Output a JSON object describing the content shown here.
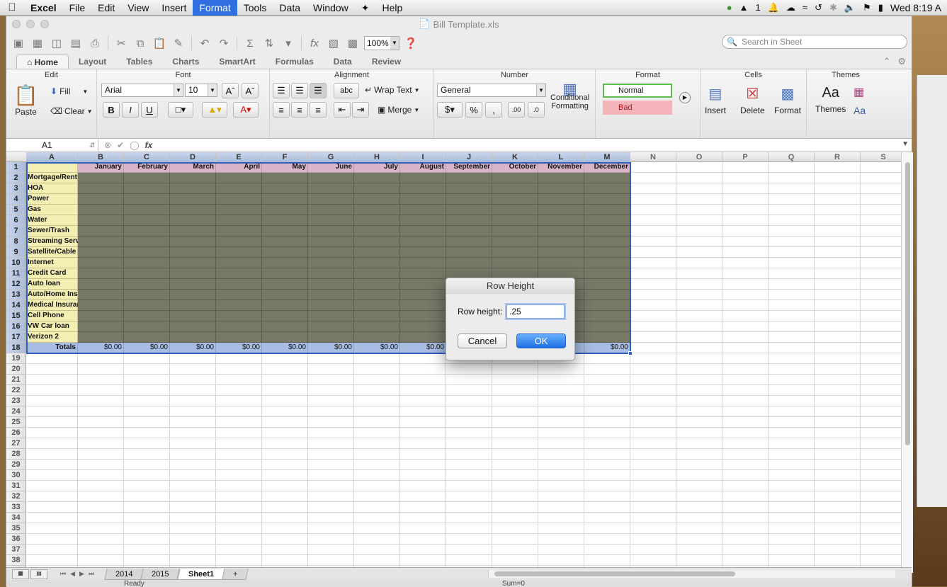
{
  "menubar": {
    "app": "Excel",
    "items": [
      "File",
      "Edit",
      "View",
      "Insert",
      "Format",
      "Tools",
      "Data",
      "Window",
      "Help"
    ],
    "active": "Format",
    "status": {
      "badge": "1",
      "clock": "Wed 8:19 A"
    }
  },
  "window": {
    "title": "Bill Template.xls"
  },
  "toolbar": {
    "zoom": "100%",
    "search_placeholder": "Search in Sheet"
  },
  "ribbon_tabs": [
    "Home",
    "Layout",
    "Tables",
    "Charts",
    "SmartArt",
    "Formulas",
    "Data",
    "Review"
  ],
  "ribbon": {
    "edit": {
      "label": "Edit",
      "paste": "Paste",
      "fill": "Fill",
      "clear": "Clear"
    },
    "font": {
      "label": "Font",
      "name": "Arial",
      "size": "10"
    },
    "alignment": {
      "label": "Alignment",
      "wrap": "Wrap Text",
      "merge": "Merge",
      "abc": "abc"
    },
    "number": {
      "label": "Number",
      "format": "General",
      "cond1": "Conditional",
      "cond2": "Formatting"
    },
    "format": {
      "label": "Format",
      "normal": "Normal",
      "bad": "Bad"
    },
    "cells": {
      "label": "Cells",
      "insert": "Insert",
      "delete": "Delete",
      "format": "Format"
    },
    "themes": {
      "label": "Themes",
      "themes": "Themes"
    }
  },
  "formula": {
    "cell_ref": "A1",
    "content": ""
  },
  "grid": {
    "columns": [
      "A",
      "B",
      "C",
      "D",
      "E",
      "F",
      "G",
      "H",
      "I",
      "J",
      "K",
      "L",
      "M",
      "N",
      "O",
      "P",
      "Q",
      "R",
      "S"
    ],
    "month_headers": [
      "January",
      "February",
      "March",
      "April",
      "May",
      "June",
      "July",
      "August",
      "September",
      "October",
      "November",
      "December"
    ],
    "bills": [
      "Mortgage/Rent",
      "HOA",
      "Power",
      "Gas",
      "Water",
      "Sewer/Trash",
      "Streaming Services",
      "Satellite/Cable",
      "Internet",
      "Credit Card",
      "Auto loan",
      "Auto/Home Insurance",
      "Medical Insurance",
      "Cell Phone",
      "VW Car loan",
      "Verizon 2"
    ],
    "totals_label": "Totals",
    "totals": [
      "$0.00",
      "$0.00",
      "$0.00",
      "$0.00",
      "$0.00",
      "$0.00",
      "$0.00",
      "$0.00",
      "",
      "",
      "",
      "$0.00"
    ],
    "row_count": 40
  },
  "sheet_tabs": [
    "2014",
    "2015",
    "Sheet1"
  ],
  "active_sheet": "Sheet1",
  "status_bar": {
    "ready": "Ready",
    "sum": "Sum=0"
  },
  "dialog": {
    "title": "Row Height",
    "label": "Row height:",
    "value": ".25",
    "cancel": "Cancel",
    "ok": "OK"
  },
  "colors": {
    "accent": "#2f6fe0",
    "header_fill": "#d9b5c9",
    "label_fill": "#f3efb3",
    "data_fill": "#787867",
    "totals_fill": "#a7bde3"
  }
}
